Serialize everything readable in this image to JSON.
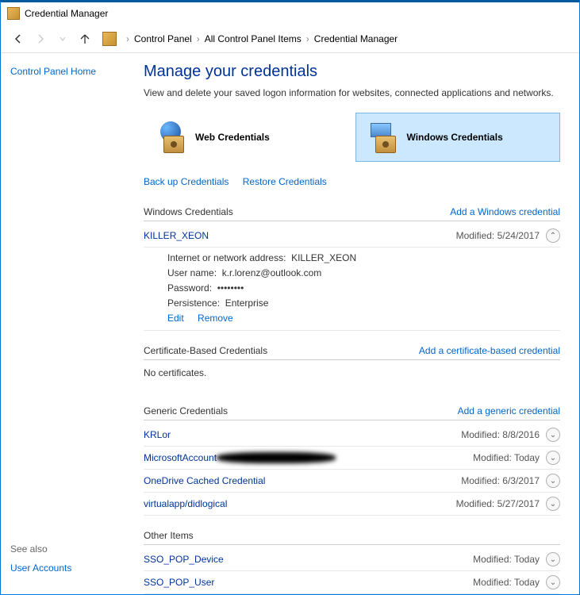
{
  "window": {
    "title": "Credential Manager"
  },
  "breadcrumb": {
    "items": [
      "Control Panel",
      "All Control Panel Items",
      "Credential Manager"
    ]
  },
  "sidebar": {
    "home": "Control Panel Home",
    "seealso": "See also",
    "useraccounts": "User Accounts"
  },
  "main": {
    "heading": "Manage your credentials",
    "subtitle": "View and delete your saved logon information for websites, connected applications and networks.",
    "tabs": {
      "web": "Web Credentials",
      "windows": "Windows Credentials"
    },
    "backup": "Back up Credentials",
    "restore": "Restore Credentials"
  },
  "sections": {
    "windows": {
      "title": "Windows Credentials",
      "add": "Add a Windows credential"
    },
    "cert": {
      "title": "Certificate-Based Credentials",
      "add": "Add a certificate-based credential",
      "empty": "No certificates."
    },
    "generic": {
      "title": "Generic Credentials",
      "add": "Add a generic credential"
    },
    "other": {
      "title": "Other Items"
    }
  },
  "expanded": {
    "name": "KILLER_XEON",
    "modified": "Modified: 5/24/2017",
    "addr_label": "Internet or network address:",
    "addr_value": "KILLER_XEON",
    "user_label": "User name:",
    "user_value": "k.r.lorenz@outlook.com",
    "pass_label": "Password:",
    "pass_value": "••••••••",
    "persist_label": "Persistence:",
    "persist_value": "Enterprise",
    "edit": "Edit",
    "remove": "Remove"
  },
  "generic_items": [
    {
      "name": "KRLor",
      "modified": "Modified: 8/8/2016"
    },
    {
      "name": "MicrosoftAccount",
      "modified": "Modified: Today",
      "redacted": true
    },
    {
      "name": "OneDrive Cached Credential",
      "modified": "Modified: 6/3/2017"
    },
    {
      "name": "virtualapp/didlogical",
      "modified": "Modified: 5/27/2017"
    }
  ],
  "other_items": [
    {
      "name": "SSO_POP_Device",
      "modified": "Modified: Today"
    },
    {
      "name": "SSO_POP_User",
      "modified": "Modified: Today"
    }
  ]
}
